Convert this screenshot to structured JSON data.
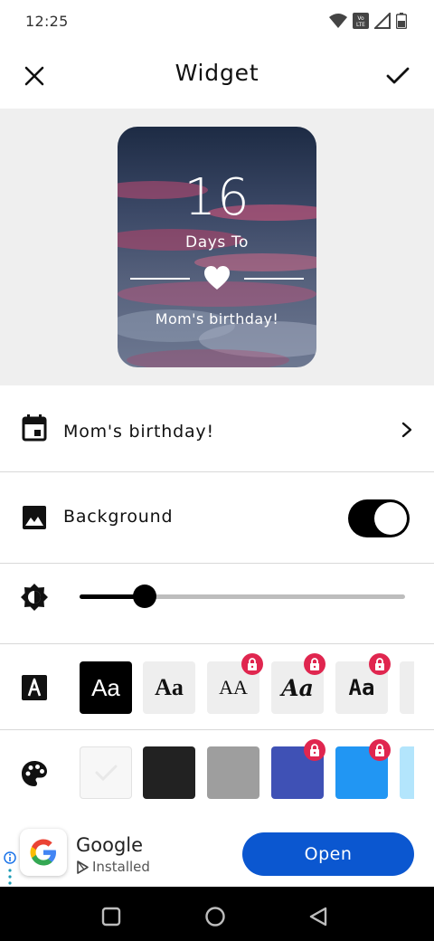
{
  "status_bar": {
    "time": "12:25",
    "volte_label": "Vo LTE"
  },
  "app_bar": {
    "title": "Widget"
  },
  "widget_preview": {
    "count": "16",
    "subtitle": "Days To",
    "event_name": "Mom's birthday!"
  },
  "rows": {
    "event": {
      "label": "Mom's birthday!"
    },
    "background": {
      "label": "Background",
      "toggle_on": true
    },
    "brightness": {
      "value_fraction": 0.2
    },
    "fonts": [
      {
        "sample": "Aa",
        "selected": true,
        "locked": false
      },
      {
        "sample": "Aa",
        "selected": false,
        "locked": false
      },
      {
        "sample": "AA",
        "selected": false,
        "locked": true
      },
      {
        "sample": "Aa",
        "selected": false,
        "locked": true
      },
      {
        "sample": "Aa",
        "selected": false,
        "locked": true
      }
    ],
    "colors": [
      {
        "hex": "#f7f7f7",
        "selected": true,
        "locked": false
      },
      {
        "hex": "#222222",
        "selected": false,
        "locked": false
      },
      {
        "hex": "#9e9e9e",
        "selected": false,
        "locked": false
      },
      {
        "hex": "#3f51b5",
        "selected": false,
        "locked": true
      },
      {
        "hex": "#2196f3",
        "selected": false,
        "locked": true
      },
      {
        "hex": "#b3e5fc",
        "selected": false,
        "locked": false
      }
    ]
  },
  "ad": {
    "app_name": "Google",
    "status": "Installed",
    "button_label": "Open"
  },
  "theme": {
    "accent": "#0b57d0",
    "lock_badge": "#e0264f"
  }
}
